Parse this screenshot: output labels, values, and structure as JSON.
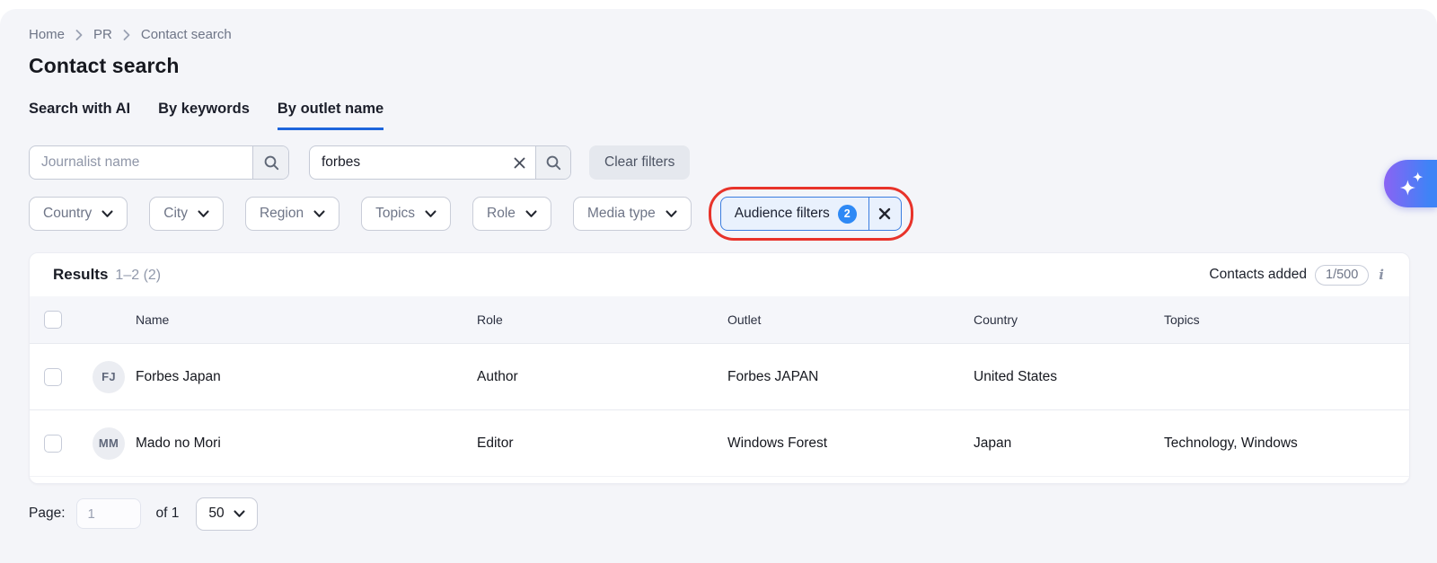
{
  "breadcrumb": {
    "items": [
      "Home",
      "PR",
      "Contact search"
    ]
  },
  "page": {
    "title": "Contact search"
  },
  "tabs": [
    {
      "label": "Search with AI"
    },
    {
      "label": "By keywords"
    },
    {
      "label": "By outlet name",
      "active": true
    }
  ],
  "search": {
    "journalist_placeholder": "Journalist name",
    "outlet_value": "forbes",
    "clear_filters_label": "Clear filters"
  },
  "filters": {
    "dropdowns": [
      {
        "label": "Country"
      },
      {
        "label": "City"
      },
      {
        "label": "Region"
      },
      {
        "label": "Topics"
      },
      {
        "label": "Role"
      },
      {
        "label": "Media type"
      }
    ],
    "audience": {
      "label": "Audience filters",
      "count": "2"
    }
  },
  "results": {
    "title": "Results",
    "range": "1–2 (2)",
    "contacts_added_label": "Contacts added",
    "contacts_added_count": "1/500"
  },
  "table": {
    "columns": [
      "Name",
      "Role",
      "Outlet",
      "Country",
      "Topics"
    ],
    "rows": [
      {
        "initials": "FJ",
        "name": "Forbes Japan",
        "role": "Author",
        "outlet": "Forbes JAPAN",
        "country": "United States",
        "topics": ""
      },
      {
        "initials": "MM",
        "name": "Mado no Mori",
        "role": "Editor",
        "outlet": "Windows Forest",
        "country": "Japan",
        "topics": "Technology, Windows"
      }
    ]
  },
  "pagination": {
    "label": "Page:",
    "current": "1",
    "of": "of 1",
    "page_size": "50"
  },
  "colors": {
    "accent_blue": "#1d65dc",
    "badge_blue": "#2e89f5",
    "annotation_red": "#e8332a",
    "background": "#f4f5f9"
  }
}
